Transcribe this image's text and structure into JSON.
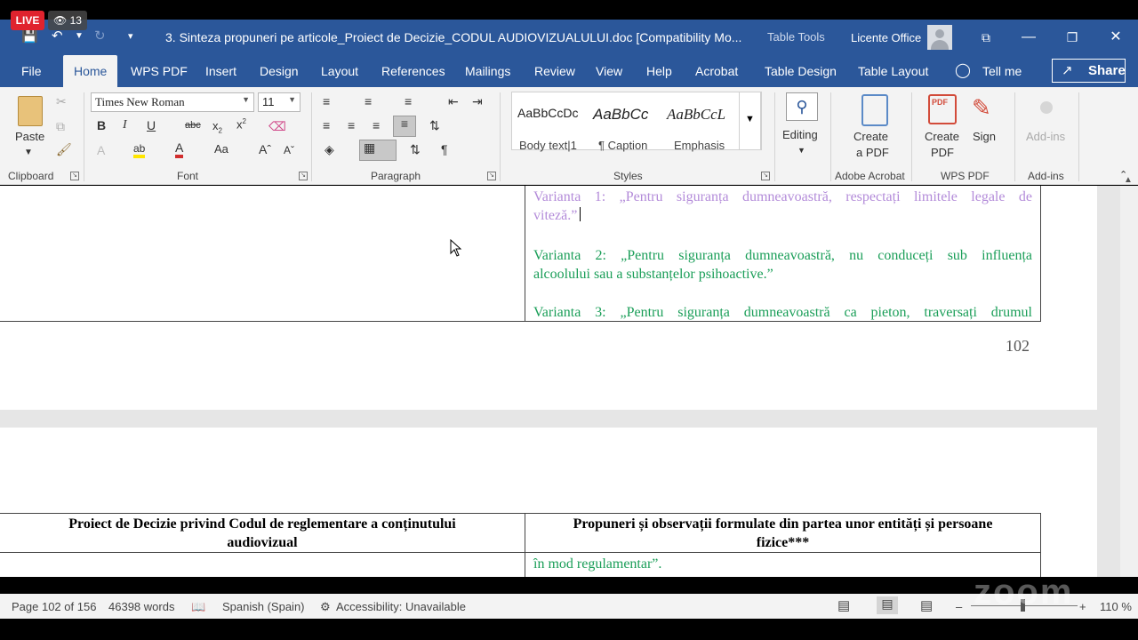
{
  "overlay": {
    "live_label": "LIVE",
    "viewers": "13",
    "watermark": "zoom"
  },
  "titlebar": {
    "title": "3. Sinteza propuneri pe articole_Proiect de Decizie_CODUL AUDIOVIZUALULUI.doc [Compatibility Mo...",
    "context_tools": "Table Tools",
    "user": "Licente Office"
  },
  "tabs": [
    "File",
    "Home",
    "WPS PDF",
    "Insert",
    "Design",
    "Layout",
    "References",
    "Mailings",
    "Review",
    "View",
    "Help",
    "Acrobat",
    "Table Design",
    "Table Layout"
  ],
  "active_tab": "Home",
  "tell_me": "Tell me",
  "share": "Share",
  "ribbon": {
    "clipboard": {
      "paste": "Paste",
      "label": "Clipboard"
    },
    "font": {
      "name": "Times New Roman",
      "size": "11",
      "label": "Font"
    },
    "paragraph": {
      "label": "Paragraph"
    },
    "styles": {
      "label": "Styles",
      "items": [
        {
          "preview": "AaBbCcDc",
          "name": "Body text|1"
        },
        {
          "preview": "AaBbCc",
          "name": "¶ Caption"
        },
        {
          "preview": "AaBbCcL",
          "name": "Emphasis"
        }
      ]
    },
    "editing": {
      "label": "Editing"
    },
    "adobe": {
      "create": "Create",
      "create2": "a PDF",
      "label": "Adobe Acrobat"
    },
    "wps": {
      "create": "Create",
      "create2": "PDF",
      "sign": "Sign",
      "label": "WPS PDF"
    },
    "addins": {
      "btn": "Add-ins",
      "label": "Add-ins"
    }
  },
  "document": {
    "variant1": "Varianta 1: „Pentru siguranța dumneavoastră, respectați limitele legale de viteză.”",
    "variant1_line1": "Varianta 1: „Pentru siguranța dumneavoastră, respectați limitele legale de",
    "variant1_line2": "viteză.”",
    "variant2_line1": "Varianta 2: „Pentru siguranța dumneavoastră, nu conduceți sub influența",
    "variant2_line2": "alcoolului sau a substanțelor psihoactive.”",
    "variant3_line1": "Varianta 3: „Pentru siguranța dumneavoastră ca pieton, traversați drumul",
    "page_number": "102",
    "header_left_line1": "Proiect de Decizie privind Codul de reglementare a conținutului",
    "header_left_line2": "audiovizual",
    "header_right_line1": "Propuneri și observații formulate din partea unor entități și persoane",
    "header_right_line2": "fizice***",
    "continuation": "în mod regulamentar”."
  },
  "status": {
    "page": "Page 102 of 156",
    "words": "46398 words",
    "language": "Spanish (Spain)",
    "accessibility": "Accessibility: Unavailable",
    "zoom": "110 %"
  },
  "colors": {
    "brand": "#2b579a",
    "green_text": "#1a9e58",
    "purple_text": "#b38bd9",
    "live": "#e0232e"
  }
}
